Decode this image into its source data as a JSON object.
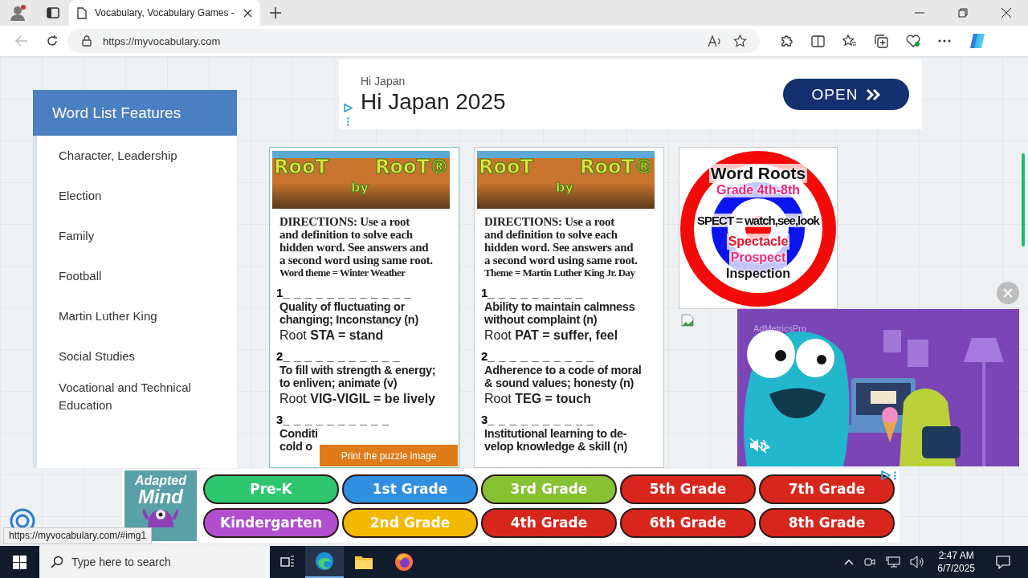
{
  "browser": {
    "tab_title": "Vocabulary, Vocabulary Games -",
    "url": "https://myvocabulary.com"
  },
  "sidebar": {
    "title": "Word List Features",
    "items": [
      {
        "label": "Character, Leadership"
      },
      {
        "label": "Election"
      },
      {
        "label": "Family"
      },
      {
        "label": "Football"
      },
      {
        "label": "Martin Luther King"
      },
      {
        "label": "Social Studies"
      },
      {
        "label": "Vocational and Technical Education"
      }
    ]
  },
  "top_ad": {
    "label": "Hi Japan",
    "headline": "Hi Japan 2025",
    "button": "OPEN"
  },
  "puzzles": [
    {
      "logo_words": [
        "RooT",
        "by",
        "RooT®"
      ],
      "directions": "DIRECTIONS: Use a root\nand definition to solve each\nhidden word. See answers and\na second word using same root.",
      "theme": "Word theme = Winter Weather",
      "items": [
        {
          "number": "1",
          "blanks": "_ _ _ _ _ _ _ _ _ _ _ _",
          "definition": "Quality of fluctuating or\nchanging; Inconstancy (n)",
          "root": "Root **STA = stand**"
        },
        {
          "number": "2",
          "blanks": "_ _ _ _ _ _ _ _ _ _ _",
          "definition": "To fill with strength & energy;\nto enliven; animate (v)",
          "root": "Root **VIG-VIGIL = be lively**"
        },
        {
          "number": "3",
          "blanks": "_ _ _ _ _ _ _ _ _ _",
          "definition": "Conditi\ncold o"
        }
      ]
    },
    {
      "logo_words": [
        "RooT",
        "by",
        "RooT®"
      ],
      "directions": "DIRECTIONS: Use a root\nand definition to solve each\nhidden word. See answers and\na second word using same root.",
      "theme": "Theme = Martin Luther King Jr. Day",
      "items": [
        {
          "number": "1",
          "blanks": "_ _ _ _ _ _ _ _ _",
          "definition": "Ability to maintain calmness\nwithout complaint (n)",
          "root": "Root **PAT = suffer, feel**"
        },
        {
          "number": "2",
          "blanks": "_ _ _ _ _ _ _ _ _ _",
          "definition": "Adherence to a code of moral\n& sound values; honesty (n)",
          "root": "Root **TEG = touch**"
        },
        {
          "number": "3",
          "blanks": "_ _ _ _ _ _ _ _ _ _",
          "definition": "Institutional learning to de-\nvelop knowledge & skill (n)"
        }
      ]
    }
  ],
  "print_button": "Print the puzzle image",
  "word_roots": {
    "title": "Word Roots",
    "grade": "Grade 4th-8th",
    "root": "SPECT = watch,see,look",
    "examples": [
      {
        "word": "Spectacle",
        "color": "#e8132a"
      },
      {
        "word": "Prospect",
        "color": "#f0287a"
      },
      {
        "word": "Inspection",
        "color": "#111111"
      }
    ]
  },
  "video_ad": {
    "brand": "AdMetricsPro"
  },
  "bottom_ad": {
    "logo": [
      "Adapted",
      "Mind"
    ],
    "grades": [
      {
        "label": "Pre-K",
        "color": "#2ec76e"
      },
      {
        "label": "1st Grade",
        "color": "#2f8fe0"
      },
      {
        "label": "3rd Grade",
        "color": "#86c232"
      },
      {
        "label": "5th Grade",
        "color": "#d9261c"
      },
      {
        "label": "7th Grade",
        "color": "#d9261c"
      },
      {
        "label": "Kindergarten",
        "color": "#b14fd0"
      },
      {
        "label": "2nd Grade",
        "color": "#f5b800"
      },
      {
        "label": "4th Grade",
        "color": "#d9261c"
      },
      {
        "label": "6th Grade",
        "color": "#d9261c"
      },
      {
        "label": "8th Grade",
        "color": "#d9261c"
      }
    ]
  },
  "status_url": "https://myvocabulary.com/#img1",
  "taskbar": {
    "search_placeholder": "Type here to search",
    "time": "2:47 AM",
    "date": "6/7/2025"
  }
}
